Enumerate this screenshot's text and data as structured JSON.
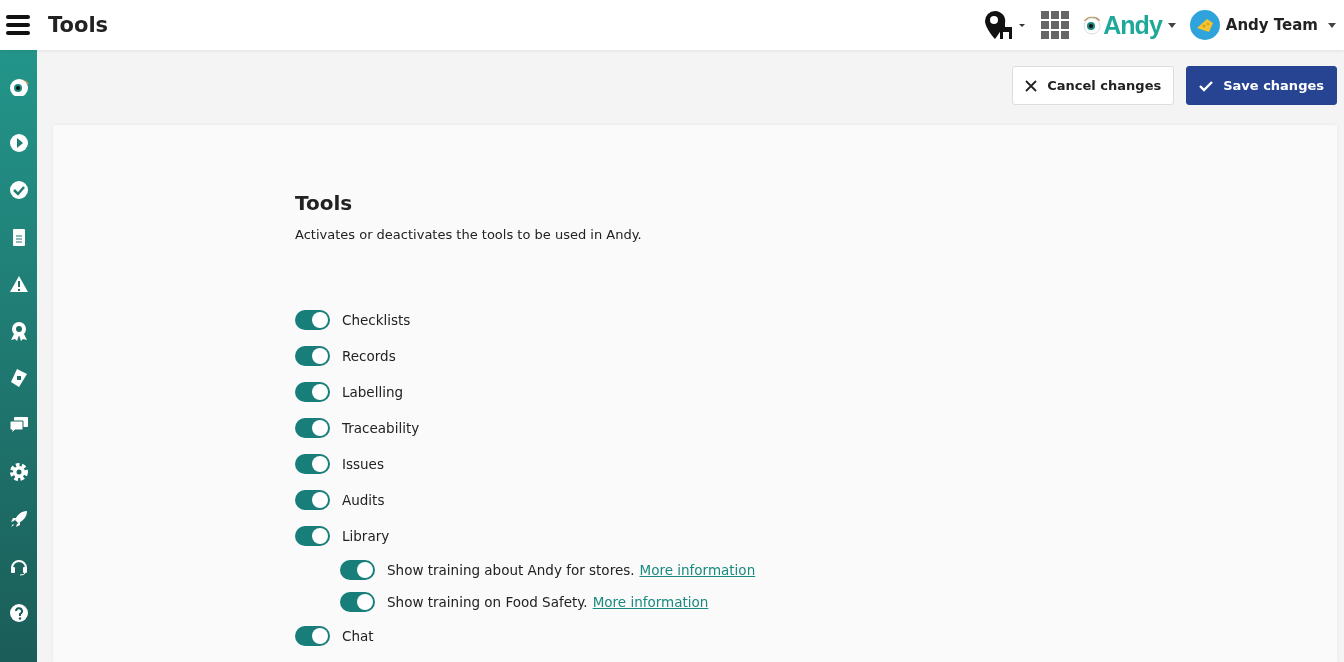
{
  "header": {
    "title": "Tools",
    "brand": "Andy",
    "account": "Andy Team"
  },
  "actions": {
    "cancel": "Cancel changes",
    "save": "Save changes"
  },
  "section": {
    "title": "Tools",
    "description": "Activates or deactivates the tools to be used in Andy."
  },
  "tools": [
    {
      "label": "Checklists",
      "on": true
    },
    {
      "label": "Records",
      "on": true
    },
    {
      "label": "Labelling",
      "on": true
    },
    {
      "label": "Traceability",
      "on": true
    },
    {
      "label": "Issues",
      "on": true
    },
    {
      "label": "Audits",
      "on": true
    },
    {
      "label": "Library",
      "on": true,
      "children": [
        {
          "label": "Show training about Andy for stores.",
          "link": "More information",
          "on": true
        },
        {
          "label": "Show training on Food Safety.",
          "link": "More information",
          "on": true
        }
      ]
    },
    {
      "label": "Chat",
      "on": true
    }
  ]
}
